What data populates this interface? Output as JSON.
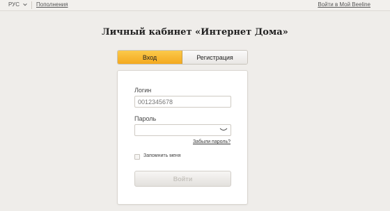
{
  "topbar": {
    "language": "РУС",
    "topup_link": "Пополнения",
    "login_link": "Войти в Мой Beeline"
  },
  "page": {
    "title": "Личный кабинет «Интернет Дома»"
  },
  "tabs": [
    {
      "label": "Вход",
      "active": true
    },
    {
      "label": "Регистрация",
      "active": false
    }
  ],
  "form": {
    "login_label": "Логин",
    "login_placeholder": "0012345678",
    "login_value": "",
    "password_label": "Пароль",
    "password_value": "",
    "forgot_link": "Забыли пароль?",
    "remember_label": "Запомнить меня",
    "remember_checked": false,
    "submit_label": "Войти"
  },
  "colors": {
    "accent": "#f4a91f",
    "background": "#efedea"
  },
  "icons": {
    "language_dropdown": "chevron-down-icon",
    "password_visibility": "eye-closed-icon"
  }
}
